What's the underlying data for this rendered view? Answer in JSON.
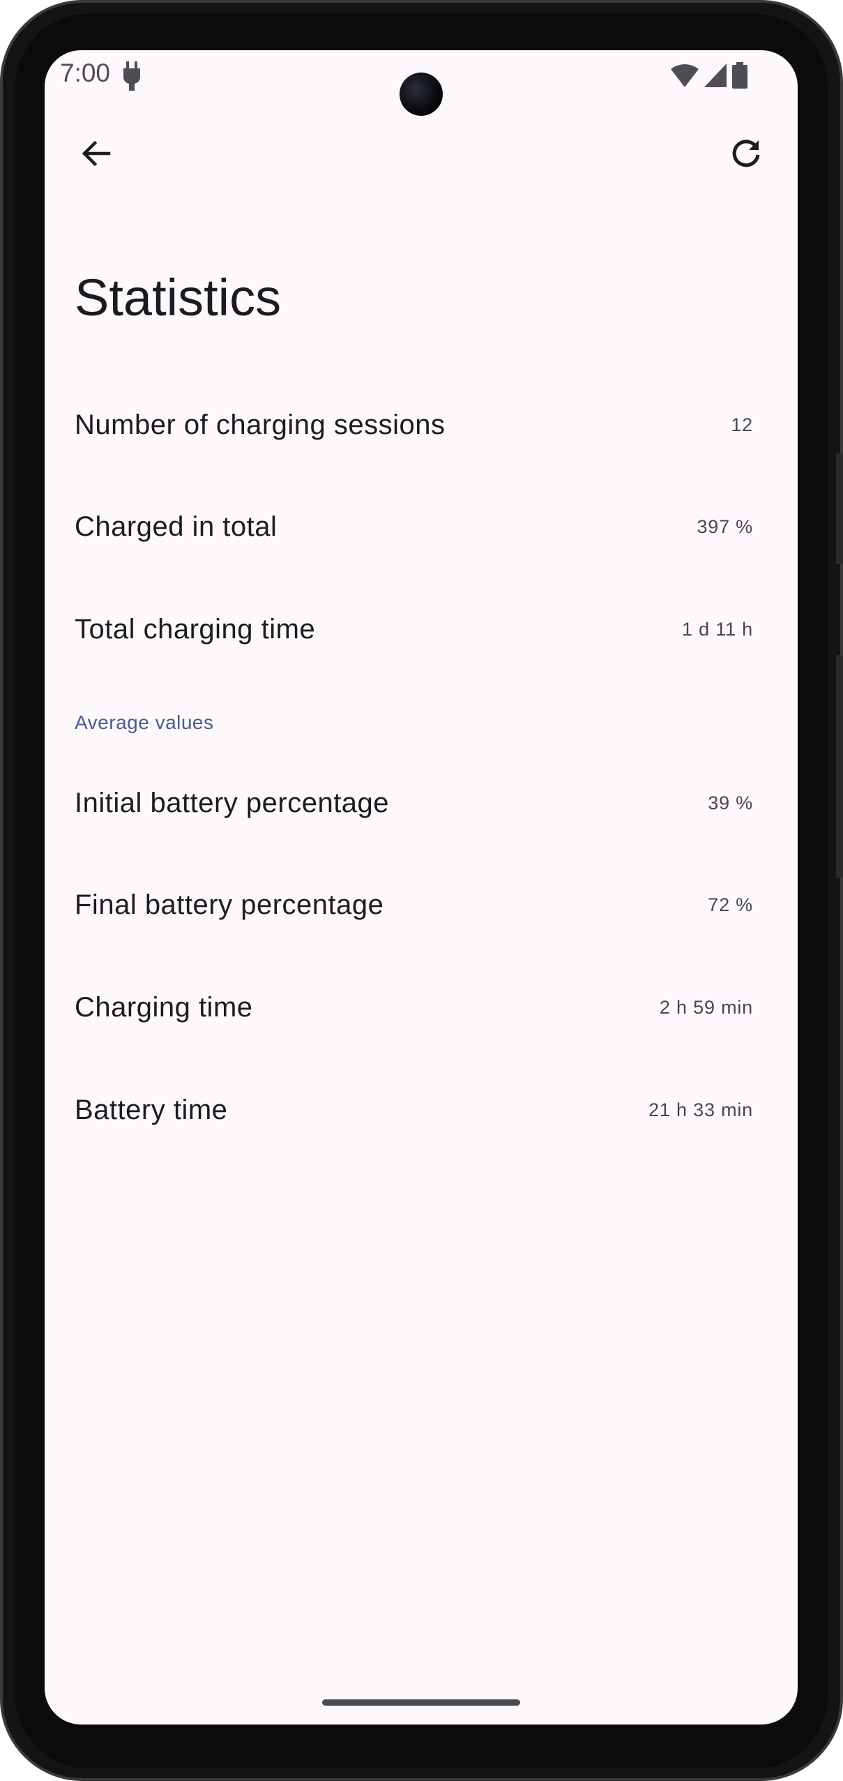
{
  "status_bar": {
    "time": "7:00",
    "icons": [
      "charging-plug-icon",
      "wifi-icon",
      "cell-signal-icon",
      "battery-icon"
    ]
  },
  "toolbar": {
    "back_icon": "arrow-back-icon",
    "refresh_icon": "refresh-icon"
  },
  "page": {
    "title": "Statistics"
  },
  "stats": [
    {
      "label": "Number of charging sessions",
      "value": "12"
    },
    {
      "label": "Charged in total",
      "value": "397 %"
    },
    {
      "label": "Total charging time",
      "value": "1 d 11 h"
    }
  ],
  "average_section": {
    "header": "Average values",
    "items": [
      {
        "label": "Initial battery percentage",
        "value": "39 %"
      },
      {
        "label": "Final battery percentage",
        "value": "72 %"
      },
      {
        "label": "Charging time",
        "value": "2 h 59 min"
      },
      {
        "label": "Battery time",
        "value": "21 h 33 min"
      }
    ]
  },
  "colors": {
    "background": "#fcf8fb",
    "text_primary": "#1c1b1f",
    "text_secondary": "#47464f",
    "section_header": "#4a5b8f"
  }
}
